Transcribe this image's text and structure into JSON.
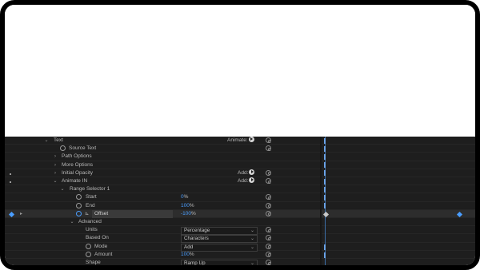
{
  "colors": {
    "panel_bg": "#1e1e1e",
    "accent_blue": "#4a9eff",
    "text_grey": "#b8b8b8",
    "canvas_bg": "#ffffff"
  },
  "layers": {
    "text_group": "Text",
    "animate_label": "Animate:",
    "source_text": "Source Text",
    "path_options": "Path Options",
    "more_options": "More Options",
    "initial_opacity": "Initial Opacity",
    "animate_in": "Animate IN",
    "add_label": "Add:",
    "range_selector": "Range Selector 1",
    "start": {
      "label": "Start",
      "value": "0",
      "unit": "%"
    },
    "end": {
      "label": "End",
      "value": "100",
      "unit": "%"
    },
    "offset": {
      "label": "Offset",
      "value": "-100",
      "unit": "%"
    },
    "advanced": "Advanced",
    "units": {
      "label": "Units",
      "value": "Percentage"
    },
    "based_on": {
      "label": "Based On",
      "value": "Characters"
    },
    "mode": {
      "label": "Mode",
      "value": "Add"
    },
    "amount": {
      "label": "Amount",
      "value": "100",
      "unit": "%"
    },
    "shape": {
      "label": "Shape",
      "value": "Ramp Up"
    }
  },
  "icons": {
    "stopwatch": "stopwatch-icon",
    "expand": "chevron-right-icon",
    "collapse": "chevron-down-icon",
    "keyframe": "keyframe-diamond-icon",
    "pick_whip": "pick-whip-icon",
    "add_menu": "add-menu-play-icon"
  }
}
